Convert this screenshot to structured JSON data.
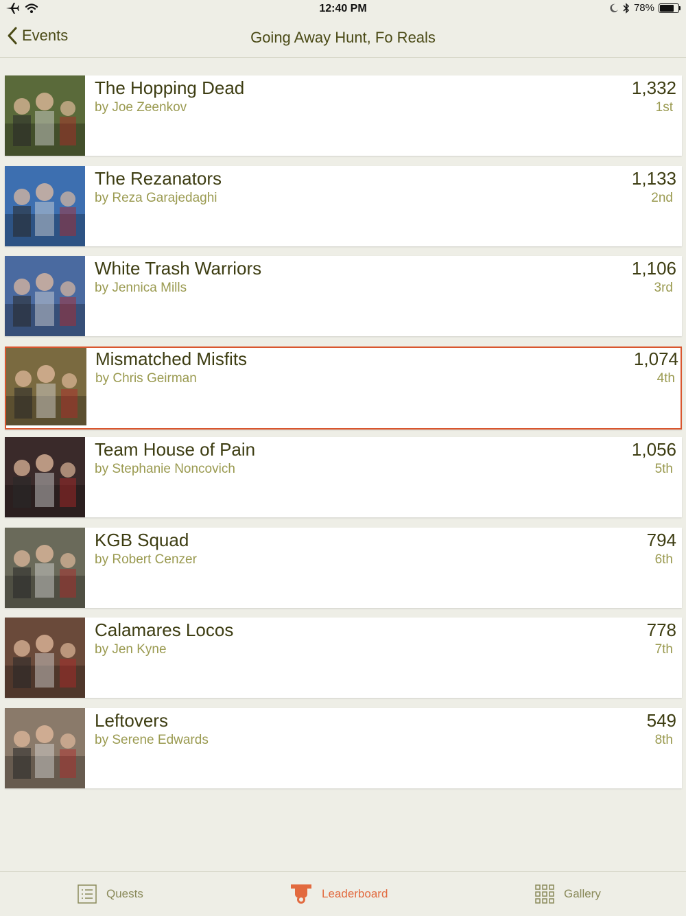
{
  "status_bar": {
    "time": "12:40 PM",
    "battery": "78%",
    "battery_level": 0.78
  },
  "nav": {
    "back_label": "Events",
    "title": "Going Away Hunt, Fo Reals"
  },
  "teams": [
    {
      "name": "The Hopping Dead",
      "owner": "by Joe Zeenkov",
      "score": "1,332",
      "rank": "1st",
      "selected": false,
      "photo": "#5a6a3a"
    },
    {
      "name": "The Rezanators",
      "owner": "by Reza Garajedaghi",
      "score": "1,133",
      "rank": "2nd",
      "selected": false,
      "photo": "#3d6fb0"
    },
    {
      "name": "White Trash Warriors",
      "owner": "by Jennica Mills",
      "score": "1,106",
      "rank": "3rd",
      "selected": false,
      "photo": "#4a6aa0"
    },
    {
      "name": "Mismatched Misfits",
      "owner": "by Chris Geirman",
      "score": "1,074",
      "rank": "4th",
      "selected": true,
      "photo": "#7a6a40"
    },
    {
      "name": "Team House of Pain",
      "owner": "by Stephanie Noncovich",
      "score": "1,056",
      "rank": "5th",
      "selected": false,
      "photo": "#3a2a2a"
    },
    {
      "name": "KGB Squad",
      "owner": "by Robert Cenzer",
      "score": "794",
      "rank": "6th",
      "selected": false,
      "photo": "#6a6a5a"
    },
    {
      "name": "Calamares Locos",
      "owner": "by Jen Kyne",
      "score": "778",
      "rank": "7th",
      "selected": false,
      "photo": "#6a4a3a"
    },
    {
      "name": "Leftovers",
      "owner": "by Serene Edwards",
      "score": "549",
      "rank": "8th",
      "selected": false,
      "photo": "#8a7a6a"
    }
  ],
  "tabs": [
    {
      "label": "Quests",
      "icon": "list-icon",
      "active": false
    },
    {
      "label": "Leaderboard",
      "icon": "trophy-icon",
      "active": true
    },
    {
      "label": "Gallery",
      "icon": "grid-icon",
      "active": false
    }
  ],
  "colors": {
    "accent": "#d9562e",
    "active_tab": "#e26a3f",
    "text_dark": "#3d3d12",
    "text_muted": "#9a9a50",
    "background": "#eeeee6"
  }
}
